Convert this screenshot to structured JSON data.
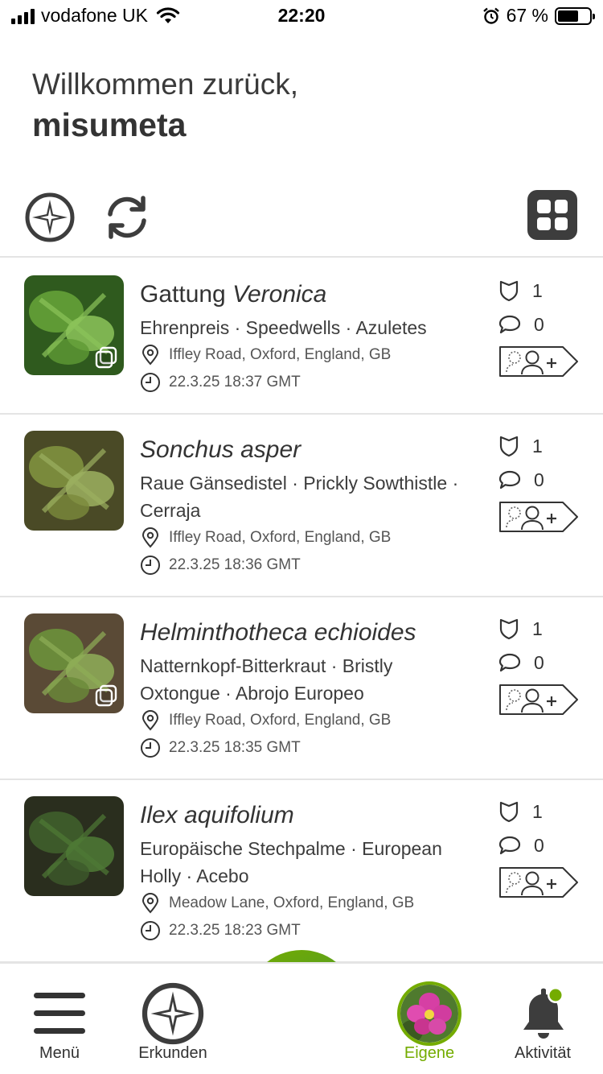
{
  "status_bar": {
    "carrier": "vodafone UK",
    "time": "22:20",
    "battery_text": "67 %",
    "battery_level": 0.67
  },
  "greeting": {
    "line1": "Willkommen zurück,",
    "username": "misumeta"
  },
  "toolbar": {
    "explore_icon": "compass-icon",
    "refresh_icon": "refresh-icon",
    "view_icon": "grid-view-icon"
  },
  "observations": [
    {
      "title_prefix": "Gattung ",
      "title_taxon": "Veronica",
      "common_names": "Ehrenpreis · Speedwells · Azuletes",
      "location": "Iffley Road, Oxford, England, GB",
      "datetime": "22.3.25 18:37 GMT",
      "faves": "1",
      "comments": "0",
      "multiple_photos": true,
      "thumb_colors": [
        "#2f5a1e",
        "#5f9a35",
        "#8cc45a"
      ]
    },
    {
      "title_prefix": "",
      "title_taxon": "Sonchus asper",
      "common_names": "Raue Gänsedistel · Prickly Sowthistle · Cerraja",
      "location": "Iffley Road, Oxford, England, GB",
      "datetime": "22.3.25 18:36 GMT",
      "faves": "1",
      "comments": "0",
      "multiple_photos": false,
      "thumb_colors": [
        "#4a4a26",
        "#7a8a3c",
        "#9cb060"
      ]
    },
    {
      "title_prefix": "",
      "title_taxon": "Helminthotheca echioides",
      "common_names": "Natternkopf-Bitterkraut · Bristly Oxtongue · Abrojo Europeo",
      "location": "Iffley Road, Oxford, England, GB",
      "datetime": "22.3.25 18:35 GMT",
      "faves": "1",
      "comments": "0",
      "multiple_photos": true,
      "thumb_colors": [
        "#5a4a36",
        "#6a8a3a",
        "#8fae58"
      ]
    },
    {
      "title_prefix": "",
      "title_taxon": "Ilex aquifolium",
      "common_names": "Europäische Stechpalme · European Holly · Acebo",
      "location": "Meadow Lane, Oxford, England, GB",
      "datetime": "22.3.25 18:23 GMT",
      "faves": "1",
      "comments": "0",
      "multiple_photos": false,
      "thumb_colors": [
        "#2a2e1e",
        "#3d5a2a",
        "#4f7a36"
      ]
    }
  ],
  "bottom_nav": {
    "menu_label": "Menü",
    "explore_label": "Erkunden",
    "own_label": "Eigene",
    "activity_label": "Aktivität",
    "accent_color": "#74ac00",
    "notification_color": "#74ac00"
  }
}
